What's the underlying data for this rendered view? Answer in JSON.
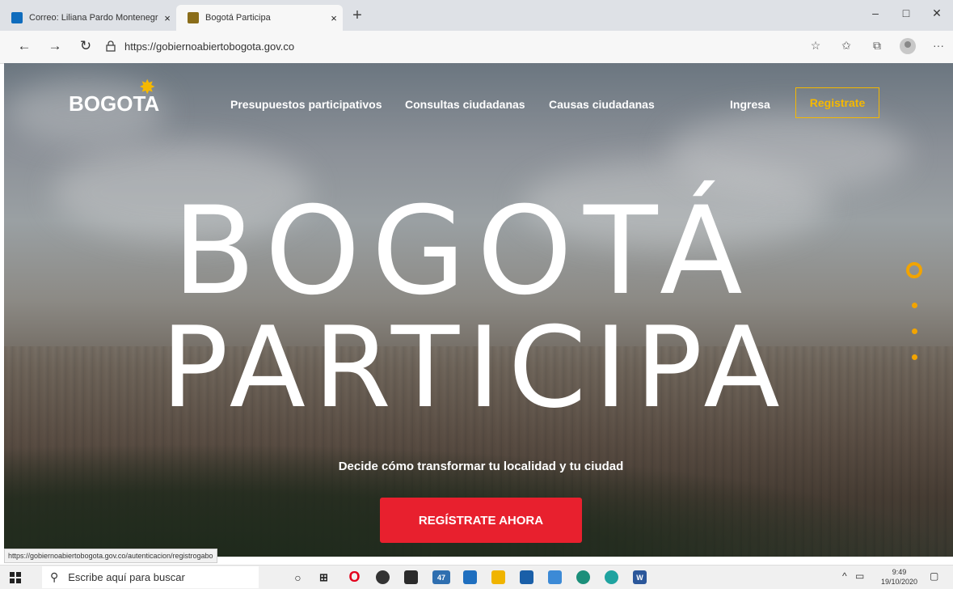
{
  "browser": {
    "tabs": [
      {
        "title": "Correo: Liliana Pardo Montenegr",
        "close": "×",
        "favicon_color": "#0f6cbd"
      },
      {
        "title": "Bogotá Participa",
        "close": "×",
        "favicon_color": "#8a6d1a"
      }
    ],
    "new_tab": "+",
    "window_controls": {
      "minimize": "–",
      "maximize": "□",
      "close": "✕"
    },
    "nav": {
      "back": "←",
      "forward": "→",
      "refresh": "↻"
    },
    "url": "https://gobiernoabiertobogota.gov.co",
    "toolbar_icons": [
      "favorite-star-icon",
      "favorites-list-icon",
      "collections-icon",
      "profile-icon",
      "more-icon"
    ],
    "more": "···"
  },
  "site": {
    "logo": "BOGOTA",
    "nav_links": [
      "Presupuestos participativos",
      "Consultas ciudadanas",
      "Causas ciudadanas"
    ],
    "login": "Ingresa",
    "register": "Registrate",
    "headline_line1": "BOGOTÁ",
    "headline_line2": "PARTICIPA",
    "tagline": "Decide cómo transformar tu localidad y tu ciudad",
    "cta": "REGÍSTRATE AHORA",
    "accent_color": "#f5b800",
    "cta_color": "#e8202e"
  },
  "status_url": "https://gobiernoabiertobogota.gov.co/autenticacion/registrogabo",
  "taskbar": {
    "search_placeholder": "Escribe aquí para buscar",
    "mail_badge": "47",
    "time": "9:49",
    "date": "19/10/2020"
  }
}
